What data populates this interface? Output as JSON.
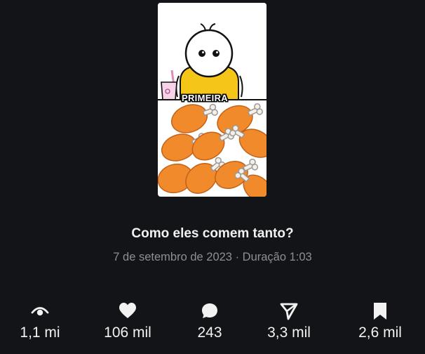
{
  "video": {
    "thumbnail_caption": "PRIMEIRA",
    "title": "Como eles comem tanto?",
    "meta": "7 de setembro de 2023 · Duração 1:03"
  },
  "stats": {
    "views": {
      "icon": "eye-icon",
      "value": "1,1 mi"
    },
    "likes": {
      "icon": "heart-icon",
      "value": "106 mil"
    },
    "comments": {
      "icon": "comment-icon",
      "value": "243"
    },
    "shares": {
      "icon": "share-icon",
      "value": "3,3 mil"
    },
    "saves": {
      "icon": "bookmark-icon",
      "value": "2,6 mil"
    }
  },
  "colors": {
    "background": "#121418",
    "text_primary": "#f2f2f2",
    "text_secondary": "#8b8f96",
    "drumstick": "#f08a2a",
    "character_shirt": "#f5c518"
  }
}
